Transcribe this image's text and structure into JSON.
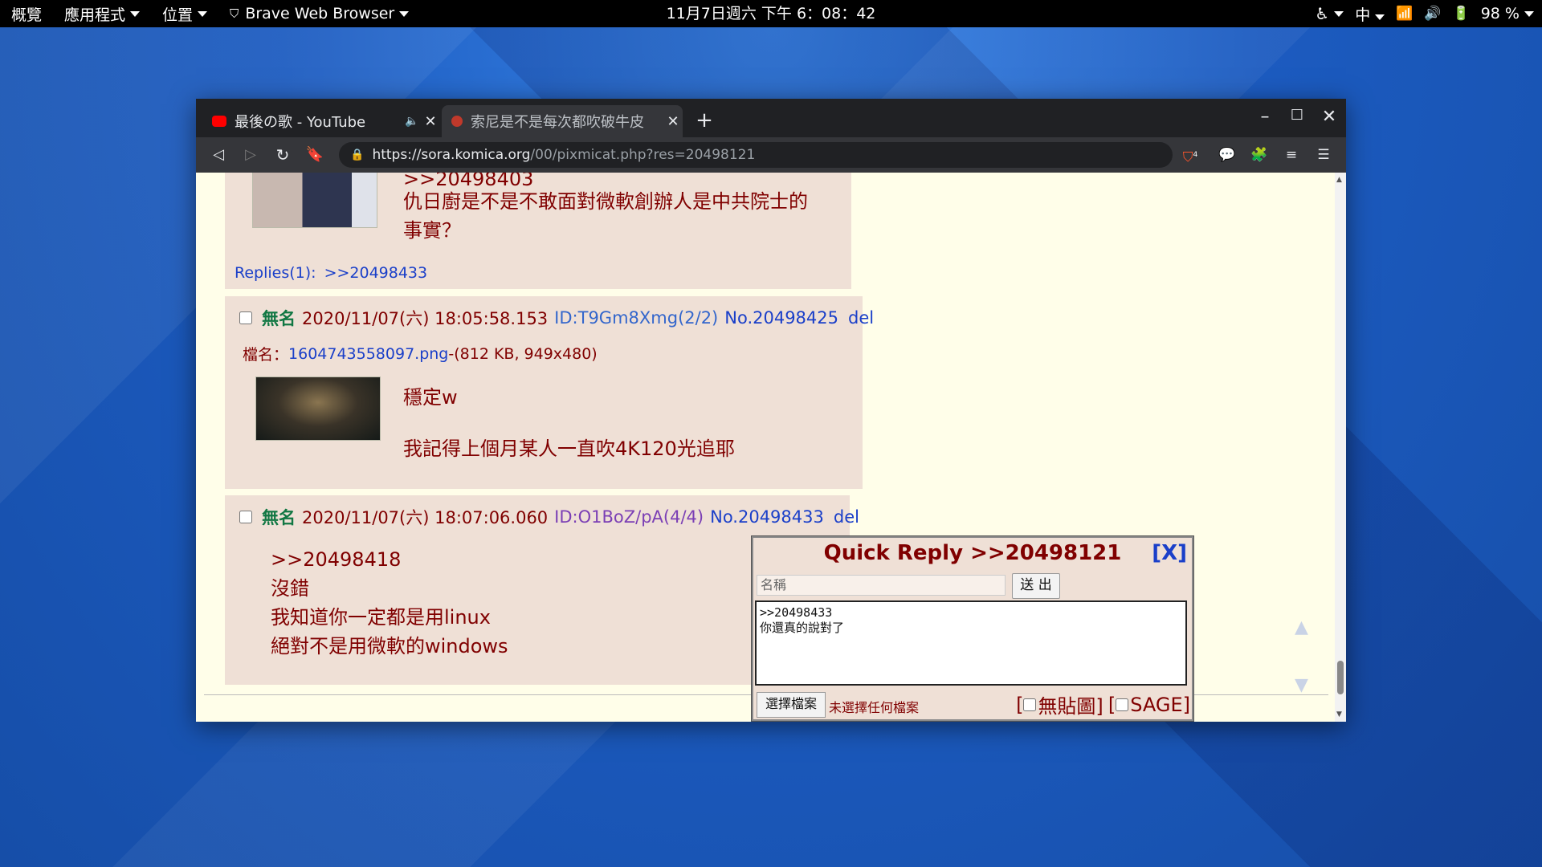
{
  "topbar": {
    "activities": "概覽",
    "applications": "應用程式",
    "places": "位置",
    "app_menu": "Brave Web Browser",
    "clock": "11月7日週六 下午 6：08：42",
    "input_method": "中",
    "battery": "98 %"
  },
  "browser": {
    "tabs": [
      {
        "title": "最後の歌 - YouTube"
      },
      {
        "title": "索尼是不是每次都吹破牛皮"
      }
    ],
    "url_host": "https://sora.komica.org",
    "url_path": "/00/pixmicat.php?res=20498121",
    "brave_badge": "4"
  },
  "posts": {
    "prev": {
      "quote": ">>20498403",
      "line1": "仇日廚是不是不敢面對微軟創辦人是中共院士的",
      "line2": "事實？",
      "replies_label": "Replies(1):",
      "replies_link": ">>20498433"
    },
    "p2": {
      "name": "無名",
      "time": "2020/11/07(六) 18:05:58.153",
      "id": "ID:T9Gm8Xmg(2/2)",
      "no": "No.20498425",
      "del": "del",
      "file_label": "檔名：",
      "file_name": "1604743558097.png",
      "file_info": "-(812 KB, 949x480)",
      "line1": "穩定w",
      "line2": "我記得上個月某人一直吹4K120光追耶"
    },
    "p3": {
      "name": "無名",
      "time": "2020/11/07(六) 18:07:06.060",
      "id": "ID:O1BoZ/pA(4/4)",
      "no": "No.20498433",
      "del": "del",
      "quote": ">>20498418",
      "line1": "沒錯",
      "line2": "我知道你一定都是用linux",
      "line3": "絕對不是用微軟的windows"
    }
  },
  "quick_reply": {
    "title": "Quick Reply >>20498121",
    "close": "[X]",
    "name_placeholder": "名稱",
    "send": "送 出",
    "text": ">>20498433\n你還真的說對了",
    "choose_file": "選擇檔案",
    "no_file": "未選擇任何檔案",
    "no_image_label": "無貼圖]",
    "sage_label": "SAGE]"
  },
  "colors": {
    "page_bg": "#fffee9",
    "post_bg": "#efe0d6",
    "text": "#800000",
    "name": "#117743",
    "link": "#1a3fc9"
  }
}
